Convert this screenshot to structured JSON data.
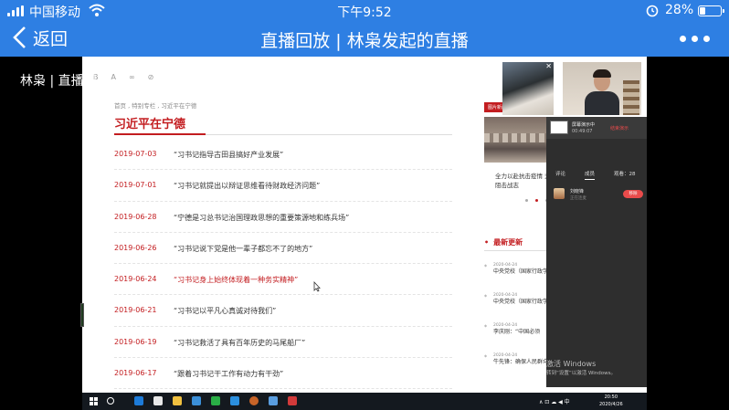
{
  "status_bar": {
    "carrier": "中国移动",
    "time": "下午9:52",
    "battery_percent": "28%",
    "battery_level": 0.28
  },
  "nav": {
    "back_label": "返回",
    "title": "直播回放 | 林枭发起的直播"
  },
  "video": {
    "host_label": "林枭 | 直播回放"
  },
  "webpage": {
    "toolbar": [
      "B",
      "A",
      "∞",
      "⊘"
    ],
    "breadcrumb": "首页 , 特别专栏 , 习近平在宁德",
    "section_title": "习近平在宁德",
    "news": [
      {
        "date": "2019-07-03",
        "title": "“习书记指导古田县搞好产业发展”"
      },
      {
        "date": "2019-07-01",
        "title": "“习书记就提出以辩证思维看待财政经济问题”"
      },
      {
        "date": "2019-06-28",
        "title": "“宁德是习总书记治国理政思想的重要策源地和练兵场”"
      },
      {
        "date": "2019-06-26",
        "title": "“习书记说下党是他一辈子都忘不了的地方”"
      },
      {
        "date": "2019-06-24",
        "title": "“习书记身上始终体现着一种务实精神”"
      },
      {
        "date": "2019-06-21",
        "title": "“习书记以平凡心真诚对待我们”"
      },
      {
        "date": "2019-06-19",
        "title": "“习书记救活了具有百年历史的马尾船厂”"
      },
      {
        "date": "2019-06-17",
        "title": "“跟着习书记干工作有动力有干劲”"
      }
    ],
    "side": {
      "tag": "图片新闻",
      "caption": "全力以赴抗击疫情 坚决打赢疫情防控阻击战志",
      "latest_heading": "最新更新",
      "latest": [
        {
          "date": "2020-04-24",
          "text": "中央党校（国家行政学院）学习汇”线上学习交"
        },
        {
          "date": "2020-04-24",
          "text": "中央党校（国家行政学院）年线上学习交流"
        },
        {
          "date": "2020-04-24",
          "text": "李庆刚：“中国必须"
        },
        {
          "date": "2020-04-24",
          "text": "牛先锋：确保人民群众体地位"
        }
      ]
    }
  },
  "live_panel": {
    "share_title": "屏幕演示中",
    "share_time": "00:49:07",
    "share_end": "结束演示",
    "tab_comment": "评论",
    "tab_members": "成员",
    "viewers": "观看：28",
    "viewer_name": "刘晓锋",
    "viewer_status": "正在连麦",
    "viewer_button": "移除",
    "close_glyph": "✕"
  },
  "windows": {
    "activate_title": "激活 Windows",
    "activate_sub": "转到“设置”以激活 Windows。",
    "tray": "∧ ⊡ ☁ ◀ 中",
    "clock_time": "20:50",
    "clock_date": "2020/4/26"
  },
  "colors": {
    "nav_blue": "#2e7fe3",
    "accent_red": "#c31d20"
  }
}
